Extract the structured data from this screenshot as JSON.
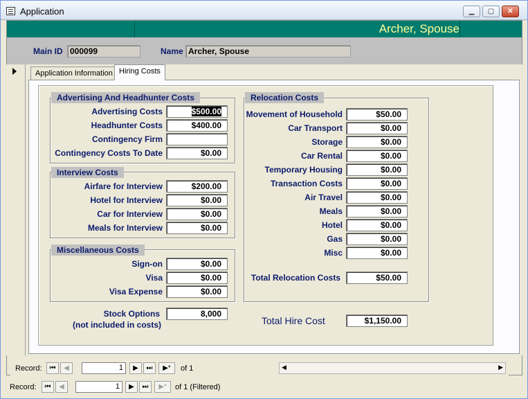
{
  "window": {
    "title": "Application"
  },
  "header": {
    "name": "Archer, Spouse"
  },
  "top": {
    "main_id_label": "Main ID",
    "main_id_value": "000099",
    "name_label": "Name",
    "name_value": "Archer, Spouse"
  },
  "tabs": [
    {
      "label": "Application Information",
      "active": false
    },
    {
      "label": "Hiring Costs",
      "active": true
    }
  ],
  "advertising": {
    "title": "Advertising And Headhunter Costs",
    "rows": [
      {
        "label": "Advertising Costs",
        "value": "$500.00"
      },
      {
        "label": "Headhunter Costs",
        "value": "$400.00"
      },
      {
        "label": "Contingency Firm",
        "value": ""
      },
      {
        "label": "Contingency Costs To Date",
        "value": "$0.00"
      }
    ]
  },
  "interview": {
    "title": "Interview Costs",
    "rows": [
      {
        "label": "Airfare for Interview",
        "value": "$200.00"
      },
      {
        "label": "Hotel for Interview",
        "value": "$0.00"
      },
      {
        "label": "Car for Interview",
        "value": "$0.00"
      },
      {
        "label": "Meals for Interview",
        "value": "$0.00"
      }
    ]
  },
  "misc": {
    "title": "Miscellaneous Costs",
    "rows": [
      {
        "label": "Sign-on",
        "value": "$0.00"
      },
      {
        "label": "Visa",
        "value": "$0.00"
      },
      {
        "label": "Visa Expense",
        "value": "$0.00"
      }
    ]
  },
  "stock": {
    "label": "Stock Options",
    "note": "(not included in costs)",
    "value": "8,000"
  },
  "relocation": {
    "title": "Relocation Costs",
    "rows": [
      {
        "label": "Movement of Household",
        "value": "$50.00"
      },
      {
        "label": "Car Transport",
        "value": "$0.00"
      },
      {
        "label": "Storage",
        "value": "$0.00"
      },
      {
        "label": "Car Rental",
        "value": "$0.00"
      },
      {
        "label": "Temporary Housing",
        "value": "$0.00"
      },
      {
        "label": "Transaction Costs",
        "value": "$0.00"
      },
      {
        "label": "Air Travel",
        "value": "$0.00"
      },
      {
        "label": "Meals",
        "value": "$0.00"
      },
      {
        "label": "Hotel",
        "value": "$0.00"
      },
      {
        "label": "Gas",
        "value": "$0.00"
      },
      {
        "label": "Misc",
        "value": "$0.00"
      }
    ],
    "total_label": "Total Relocation Costs",
    "total_value": "$50.00"
  },
  "total_hire": {
    "label": "Total Hire Cost",
    "value": "$1,150.00"
  },
  "subform_nav": {
    "record_label": "Record:",
    "current": "1",
    "of_text": "of  1"
  },
  "main_nav": {
    "record_label": "Record:",
    "current": "1",
    "of_text": "of  1 (Filtered)"
  },
  "nav_icons": {
    "first": "⏮",
    "prev": "◀",
    "next": "▶",
    "last": "⏭",
    "new": "▶*"
  }
}
